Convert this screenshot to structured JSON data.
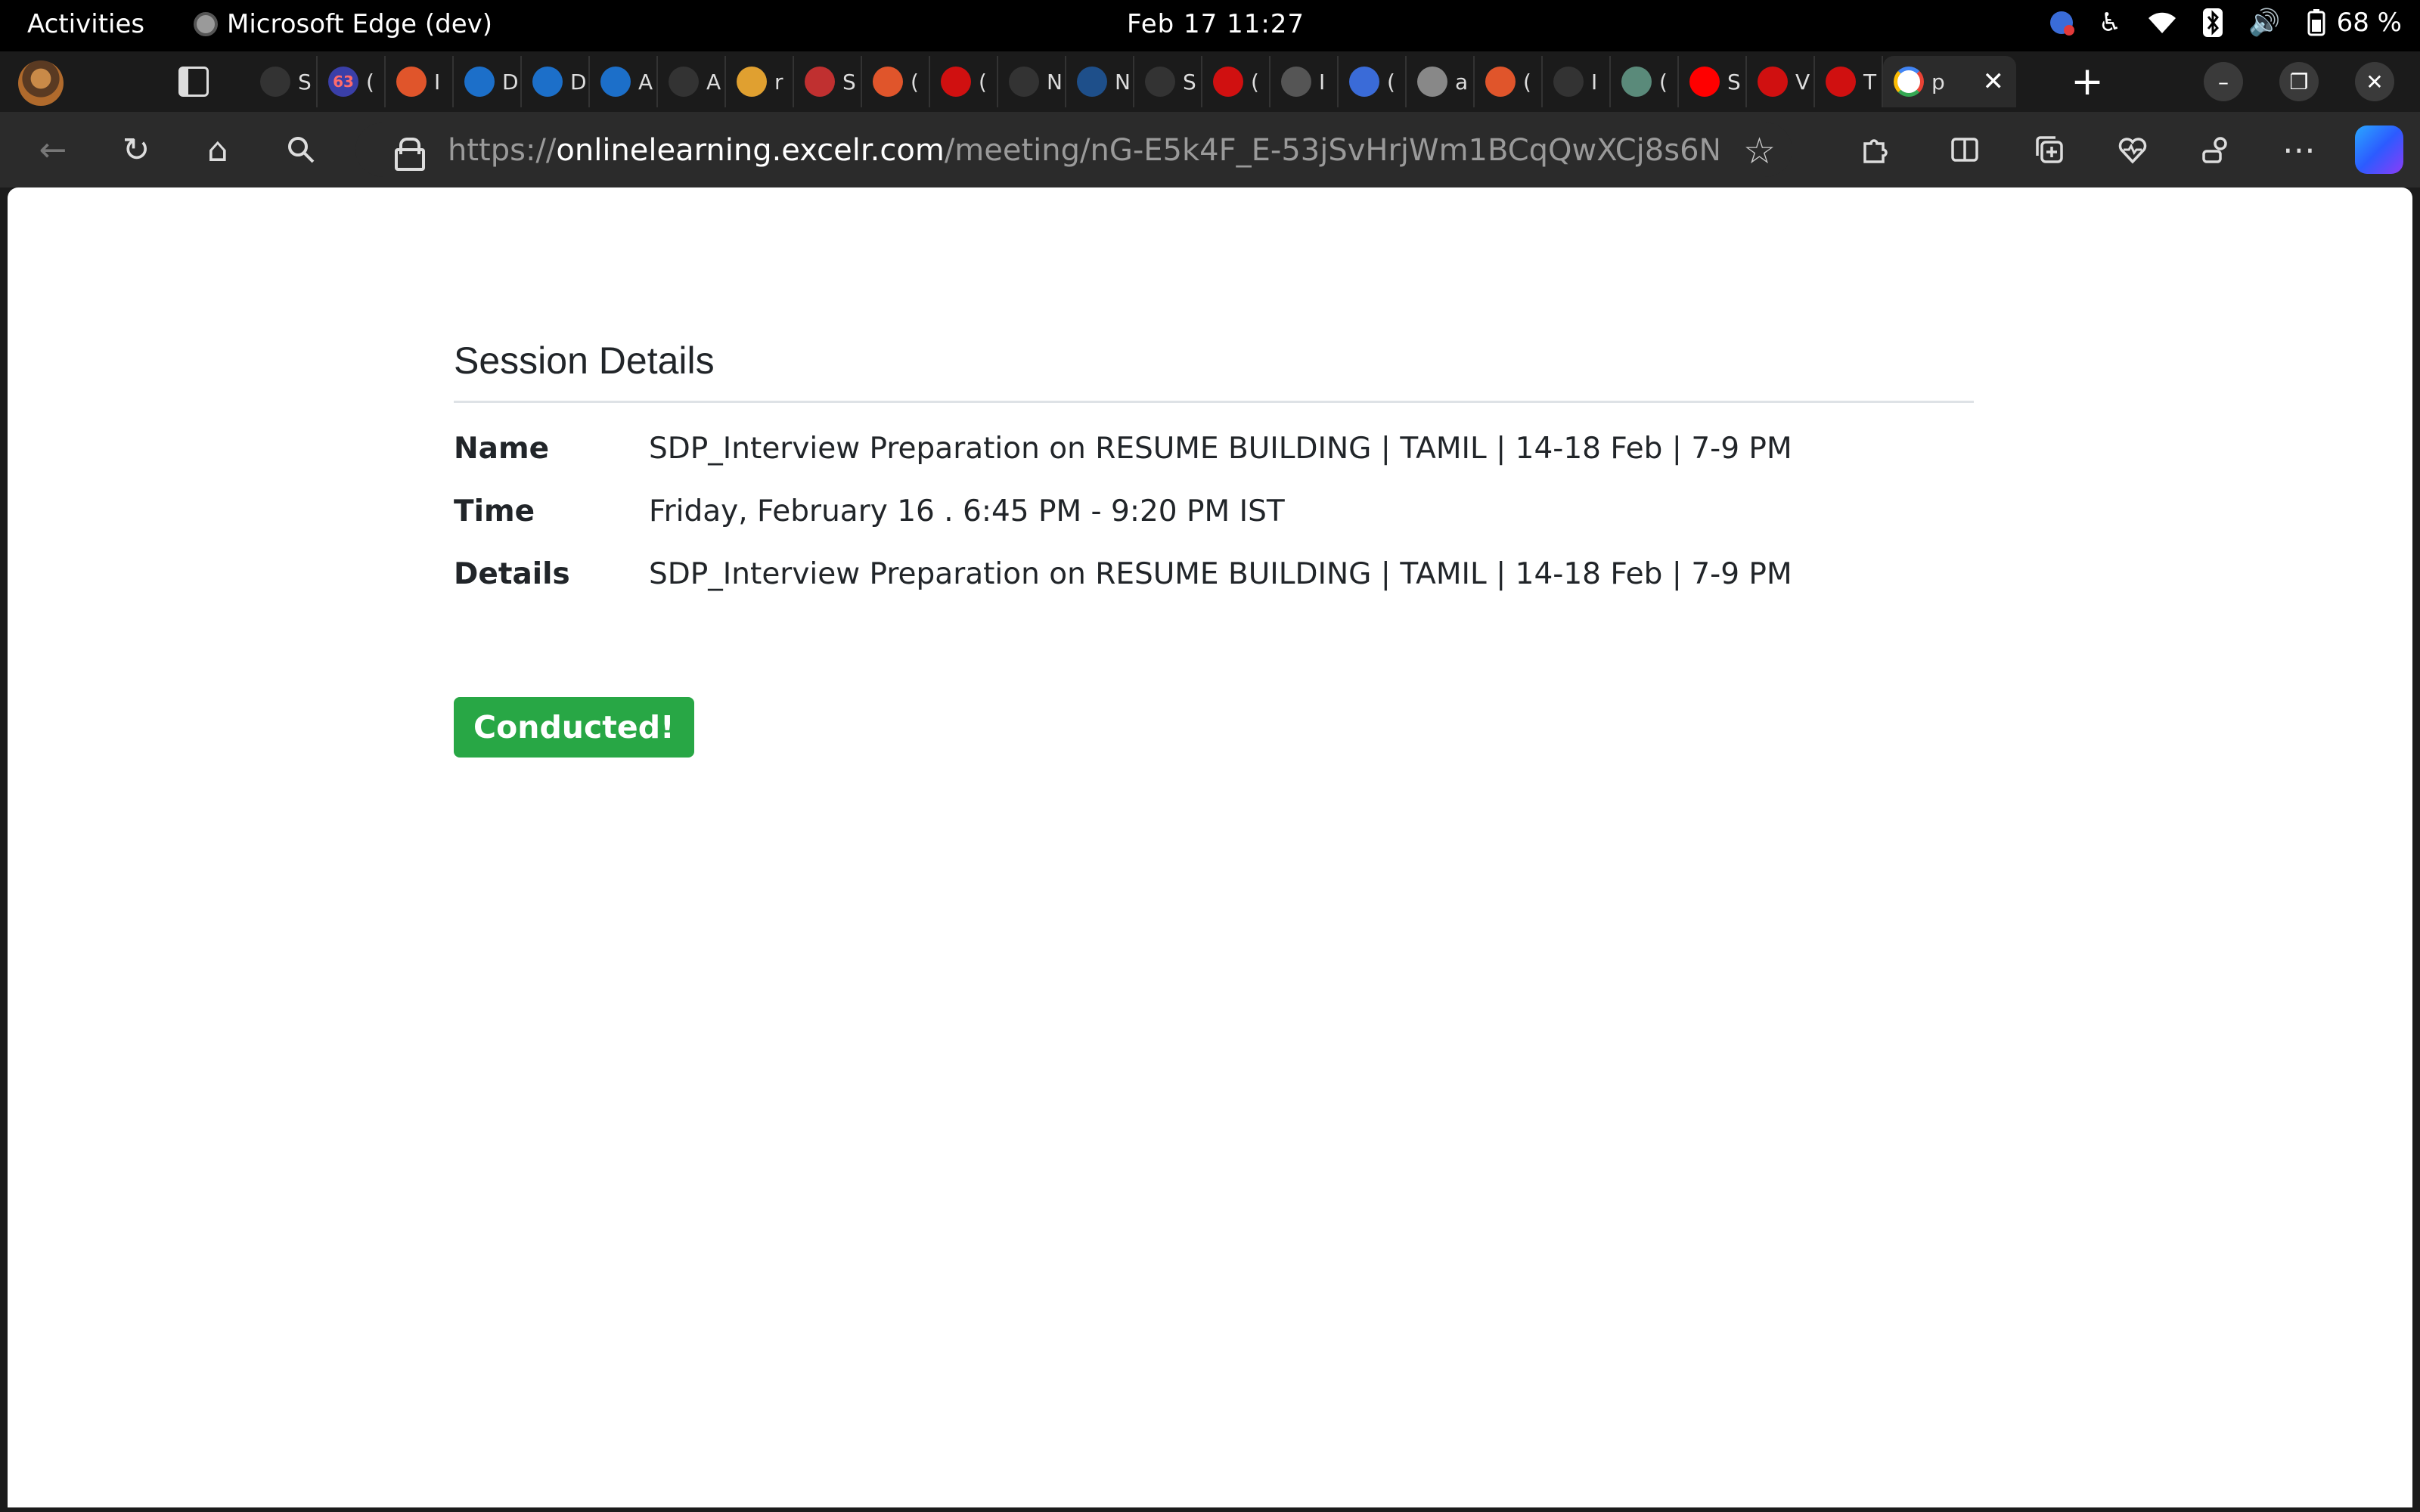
{
  "system_bar": {
    "activities_label": "Activities",
    "app_name": "Microsoft Edge (dev)",
    "clock": "Feb 17  11:27",
    "battery": "68 %"
  },
  "tabs": {
    "tab_glyphs": [
      "S",
      "(",
      "I",
      "D",
      "D",
      "A",
      "A",
      "r",
      "S",
      "(",
      "(",
      "N",
      "N",
      "S",
      "(",
      "I",
      "(",
      "a",
      "(",
      "I",
      "(",
      "S",
      "V",
      "T",
      "p"
    ],
    "badge_count": "63"
  },
  "address_bar": {
    "url_scheme": "https://",
    "url_host": "onlinelearning.excelr.com",
    "url_path": "/meeting/nG-E5k4F_E-53jSvHrjWm1BCqQwXCj8s6N..."
  },
  "session": {
    "title": "Session Details",
    "rows": [
      {
        "label": "Name",
        "value": "SDP_Interview Preparation on RESUME BUILDING | TAMIL | 14-18 Feb | 7-9 PM"
      },
      {
        "label": "Time",
        "value": "Friday, February 16 . 6:45 PM - 9:20 PM IST"
      },
      {
        "label": "Details",
        "value": "SDP_Interview Preparation on RESUME BUILDING | TAMIL | 14-18 Feb | 7-9 PM"
      }
    ],
    "status": "Conducted!"
  },
  "colors": {
    "status_green": "#28a745",
    "text_dark": "#212529",
    "chrome_dark": "#2b2b2b"
  }
}
